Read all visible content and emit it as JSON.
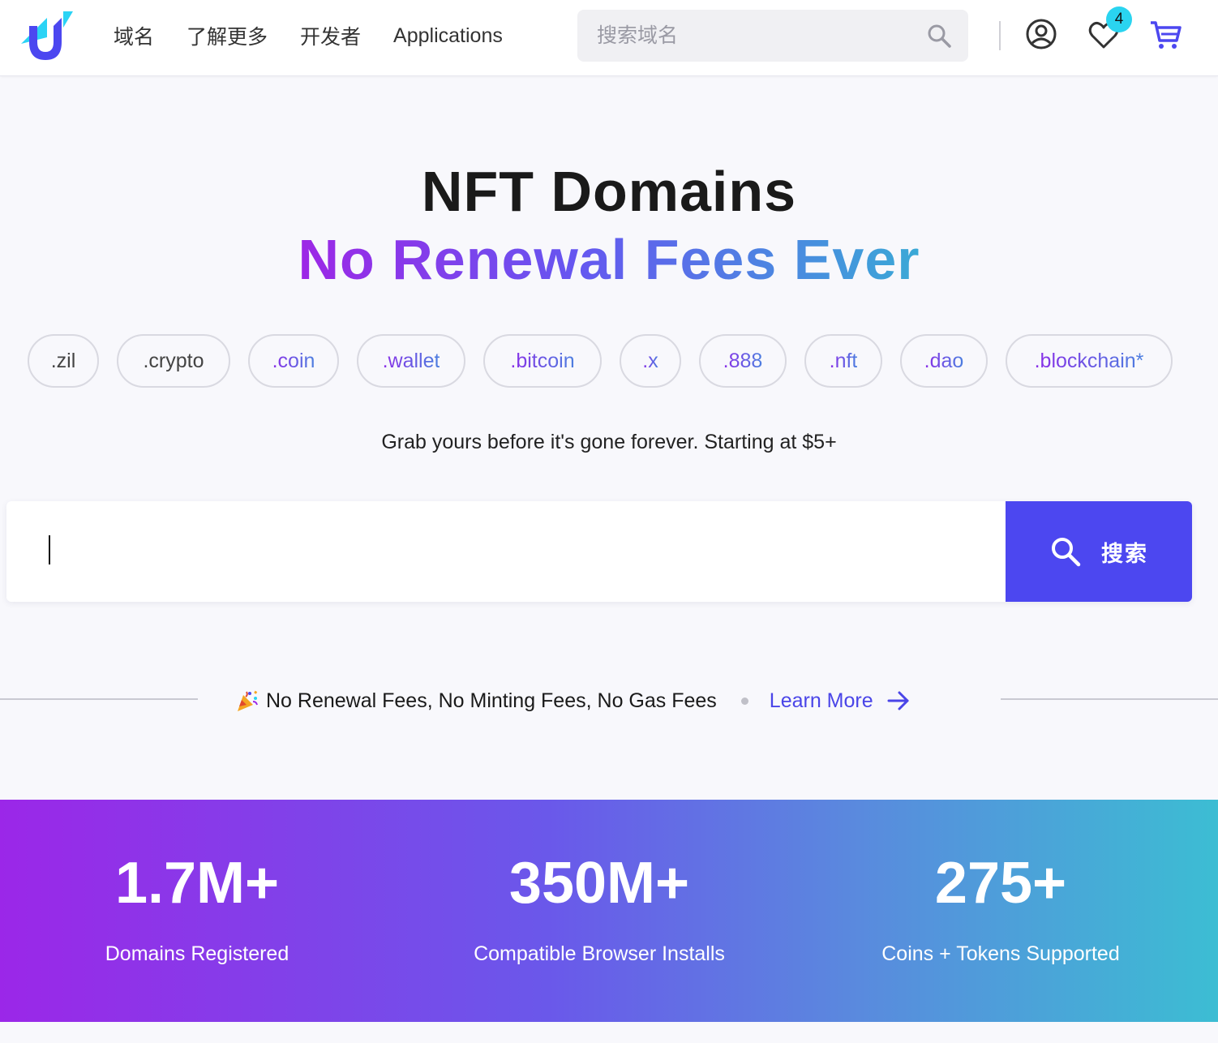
{
  "header": {
    "nav": [
      "域名",
      "了解更多",
      "开发者",
      "Applications"
    ],
    "search_placeholder": "搜索域名",
    "favorites_count": "4",
    "icons": {
      "logo": "unstoppable-logo",
      "search": "search-icon",
      "account": "account-circle-icon",
      "favorites": "heart-icon",
      "cart": "cart-icon"
    }
  },
  "hero": {
    "title": "NFT Domains",
    "subtitle": "No Renewal Fees Ever",
    "tlds": [
      ".zil",
      ".crypto",
      ".coin",
      ".wallet",
      ".bitcoin",
      ".x",
      ".888",
      ".nft",
      ".dao",
      ".blockchain*"
    ],
    "tagline": "Grab yours before it's gone forever. Starting at $5+",
    "search_value": "",
    "search_button": "搜索"
  },
  "promo": {
    "text": "No Renewal Fees, No Minting Fees, No Gas Fees",
    "link": "Learn More"
  },
  "stats": [
    {
      "value": "1.7M+",
      "label": "Domains Registered"
    },
    {
      "value": "350M+",
      "label": "Compatible Browser Installs"
    },
    {
      "value": "275+",
      "label": "Coins + Tokens Supported"
    }
  ],
  "colors": {
    "accent": "#4c47f0",
    "badge": "#2ad4f0",
    "gradient_start": "#9b27e8",
    "gradient_end": "#3cbdd3"
  }
}
